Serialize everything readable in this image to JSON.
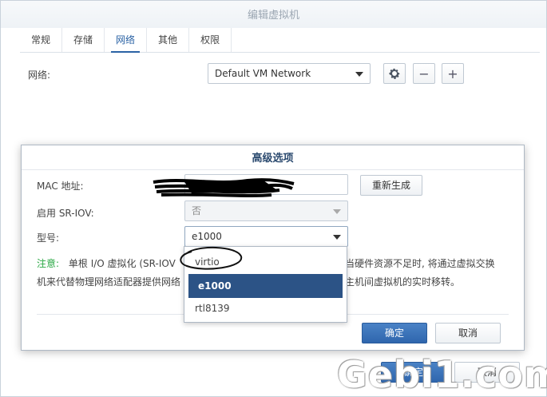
{
  "main": {
    "title": "编辑虚拟机",
    "tabs": [
      {
        "label": "常规"
      },
      {
        "label": "存储"
      },
      {
        "label": "网络",
        "active": true
      },
      {
        "label": "其他"
      },
      {
        "label": "权限"
      }
    ],
    "network_label": "网络:",
    "network_select": "Default VM Network",
    "bottom_ok": "确定",
    "bottom_cancel": "取消"
  },
  "advanced": {
    "title": "高级选项",
    "mac_label": "MAC 地址:",
    "mac_value": "",
    "regenerate": "重新生成",
    "sriov_label": "启用 SR-IOV:",
    "sriov_value": "否",
    "model_label": "型号:",
    "model_value": "e1000",
    "note_keyword": "注意:",
    "note_line1": "单根 I/O 虚拟化 (SR-IOV",
    "note_line1_tail": "当硬件资源不足时, 将通过虚拟交换",
    "note_line2": "机来代替物理网络适配器提供网络",
    "note_line2_tail": "主机间虚拟机的实时移转。",
    "ok": "确定",
    "cancel": "取消"
  },
  "model_options": [
    "virtio",
    "e1000",
    "rtl8139"
  ],
  "watermark": "Gebi1.com"
}
